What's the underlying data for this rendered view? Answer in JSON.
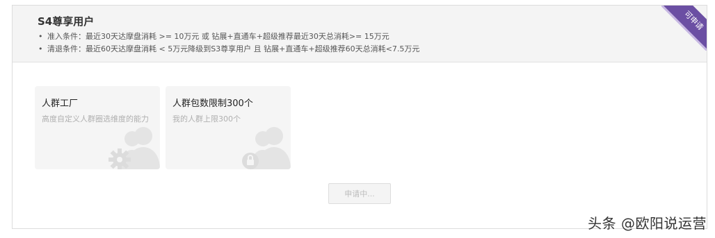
{
  "panel": {
    "title": "S4尊享用户",
    "ribbon_label": "可申请",
    "conditions": [
      "准入条件：最近30天达摩盘消耗 >= 10万元 或 钻展+直通车+超级推荐最近30天总消耗>= 15万元",
      "清退条件：最近60天达摩盘消耗 < 5万元降级到S3尊享用户 且 钻展+直通车+超级推荐60天总消耗<7.5万元"
    ],
    "bullet": "•"
  },
  "cards": [
    {
      "title": "人群工厂",
      "description": "高度自定义人群圈选维度的能力",
      "icon": "users-gear-icon"
    },
    {
      "title": "人群包数限制300个",
      "description": "我的人群上限300个",
      "icon": "users-lock-icon"
    }
  ],
  "apply_button": {
    "label": "申请中..."
  },
  "watermark": "头条 @欧阳说运营",
  "colors": {
    "ribbon": "#6b4fa3",
    "header_bg": "#f4f4f4",
    "card_bg": "#f5f5f5",
    "icon": "#e6e6e6"
  }
}
